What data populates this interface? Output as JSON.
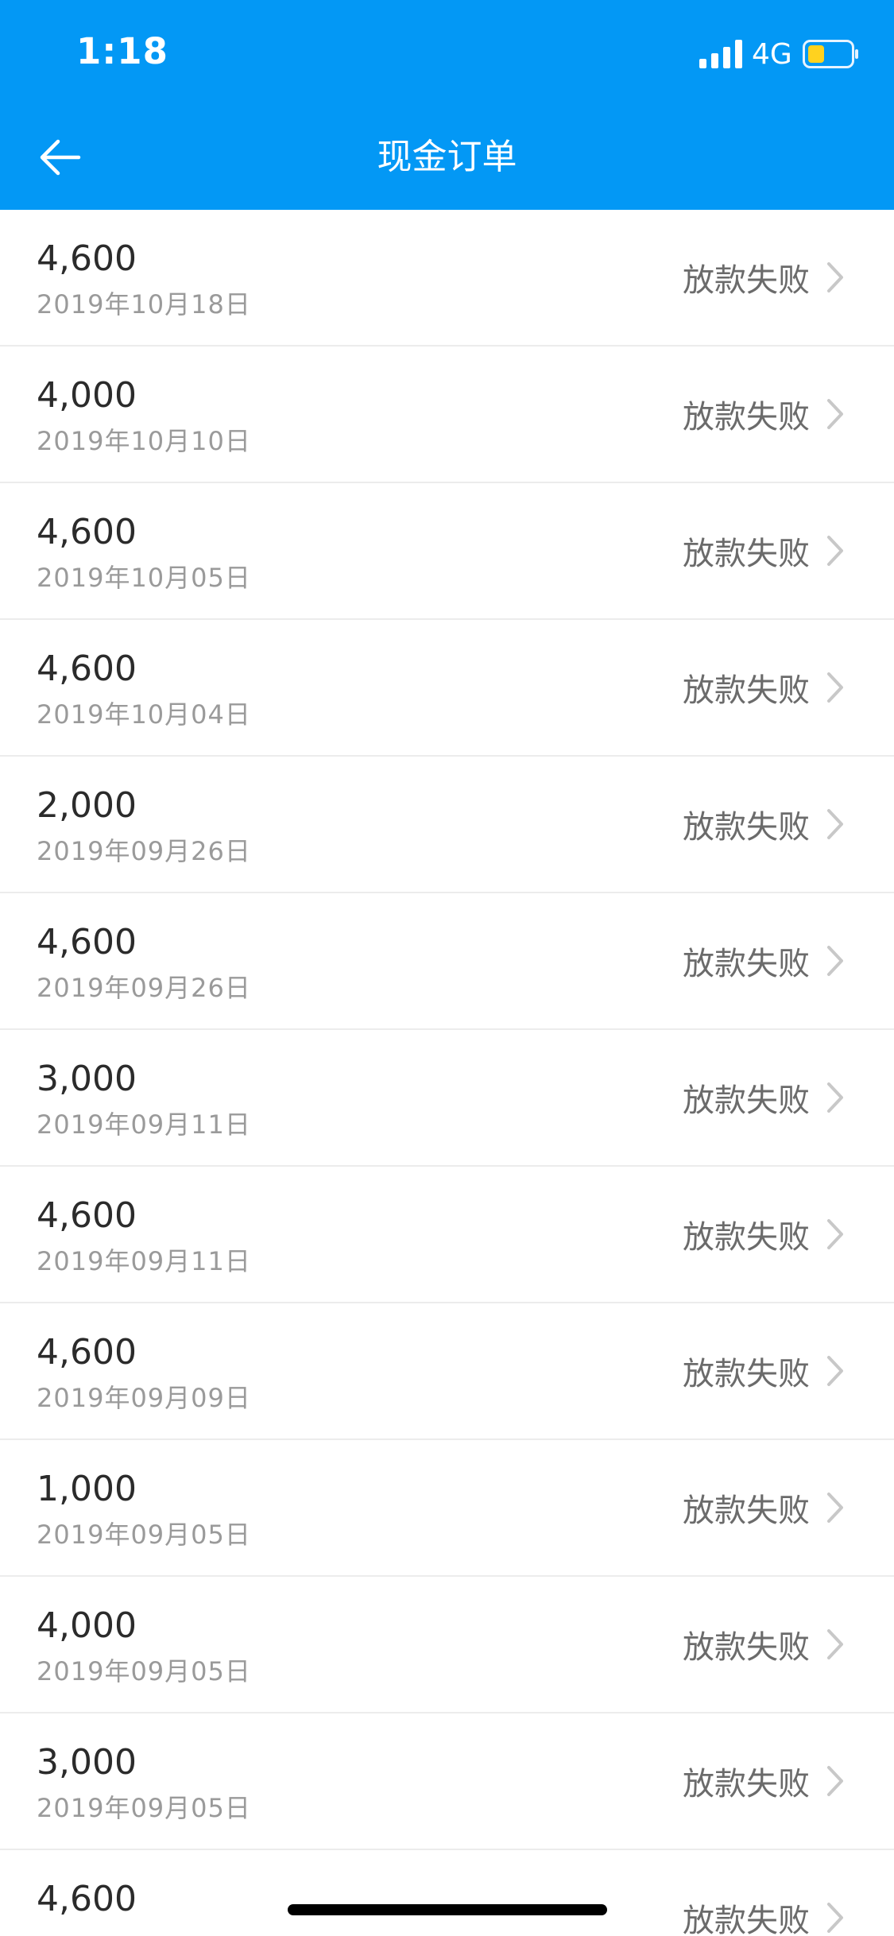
{
  "status_bar": {
    "time": "1:18",
    "network": "4G",
    "signal_icon": "cellular-signal-icon",
    "battery_icon": "battery-icon"
  },
  "nav": {
    "title": "现金订单",
    "back_icon": "arrow-left-icon"
  },
  "colors": {
    "header_bg": "#0398f5",
    "battery_fill": "#ffd21f"
  },
  "orders": [
    {
      "amount": "4,600",
      "date": "2019年10月18日",
      "status": "放款失败"
    },
    {
      "amount": "4,000",
      "date": "2019年10月10日",
      "status": "放款失败"
    },
    {
      "amount": "4,600",
      "date": "2019年10月05日",
      "status": "放款失败"
    },
    {
      "amount": "4,600",
      "date": "2019年10月04日",
      "status": "放款失败"
    },
    {
      "amount": "2,000",
      "date": "2019年09月26日",
      "status": "放款失败"
    },
    {
      "amount": "4,600",
      "date": "2019年09月26日",
      "status": "放款失败"
    },
    {
      "amount": "3,000",
      "date": "2019年09月11日",
      "status": "放款失败"
    },
    {
      "amount": "4,600",
      "date": "2019年09月11日",
      "status": "放款失败"
    },
    {
      "amount": "4,600",
      "date": "2019年09月09日",
      "status": "放款失败"
    },
    {
      "amount": "1,000",
      "date": "2019年09月05日",
      "status": "放款失败"
    },
    {
      "amount": "4,000",
      "date": "2019年09月05日",
      "status": "放款失败"
    },
    {
      "amount": "3,000",
      "date": "2019年09月05日",
      "status": "放款失败"
    },
    {
      "amount": "4,600",
      "date": "",
      "status": "放款失败"
    }
  ]
}
